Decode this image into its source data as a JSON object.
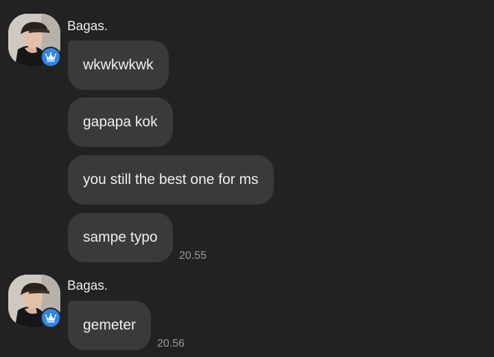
{
  "chat": {
    "groups": [
      {
        "sender": "Bagas.",
        "messages": [
          "wkwkwkwk",
          "gapapa kok",
          "you still the best one for ms",
          "sampe typo"
        ],
        "time": "20.55"
      },
      {
        "sender": "Bagas.",
        "messages": [
          "gemeter"
        ],
        "time": "20.56"
      }
    ]
  },
  "colors": {
    "background": "#222222",
    "bubble": "#3a3a3a",
    "badge": "#2f86e8",
    "text": "#ececec",
    "timestamp": "#9a9a9a"
  },
  "icons": {
    "badge": "crown-icon",
    "avatar": "profile-photo"
  }
}
